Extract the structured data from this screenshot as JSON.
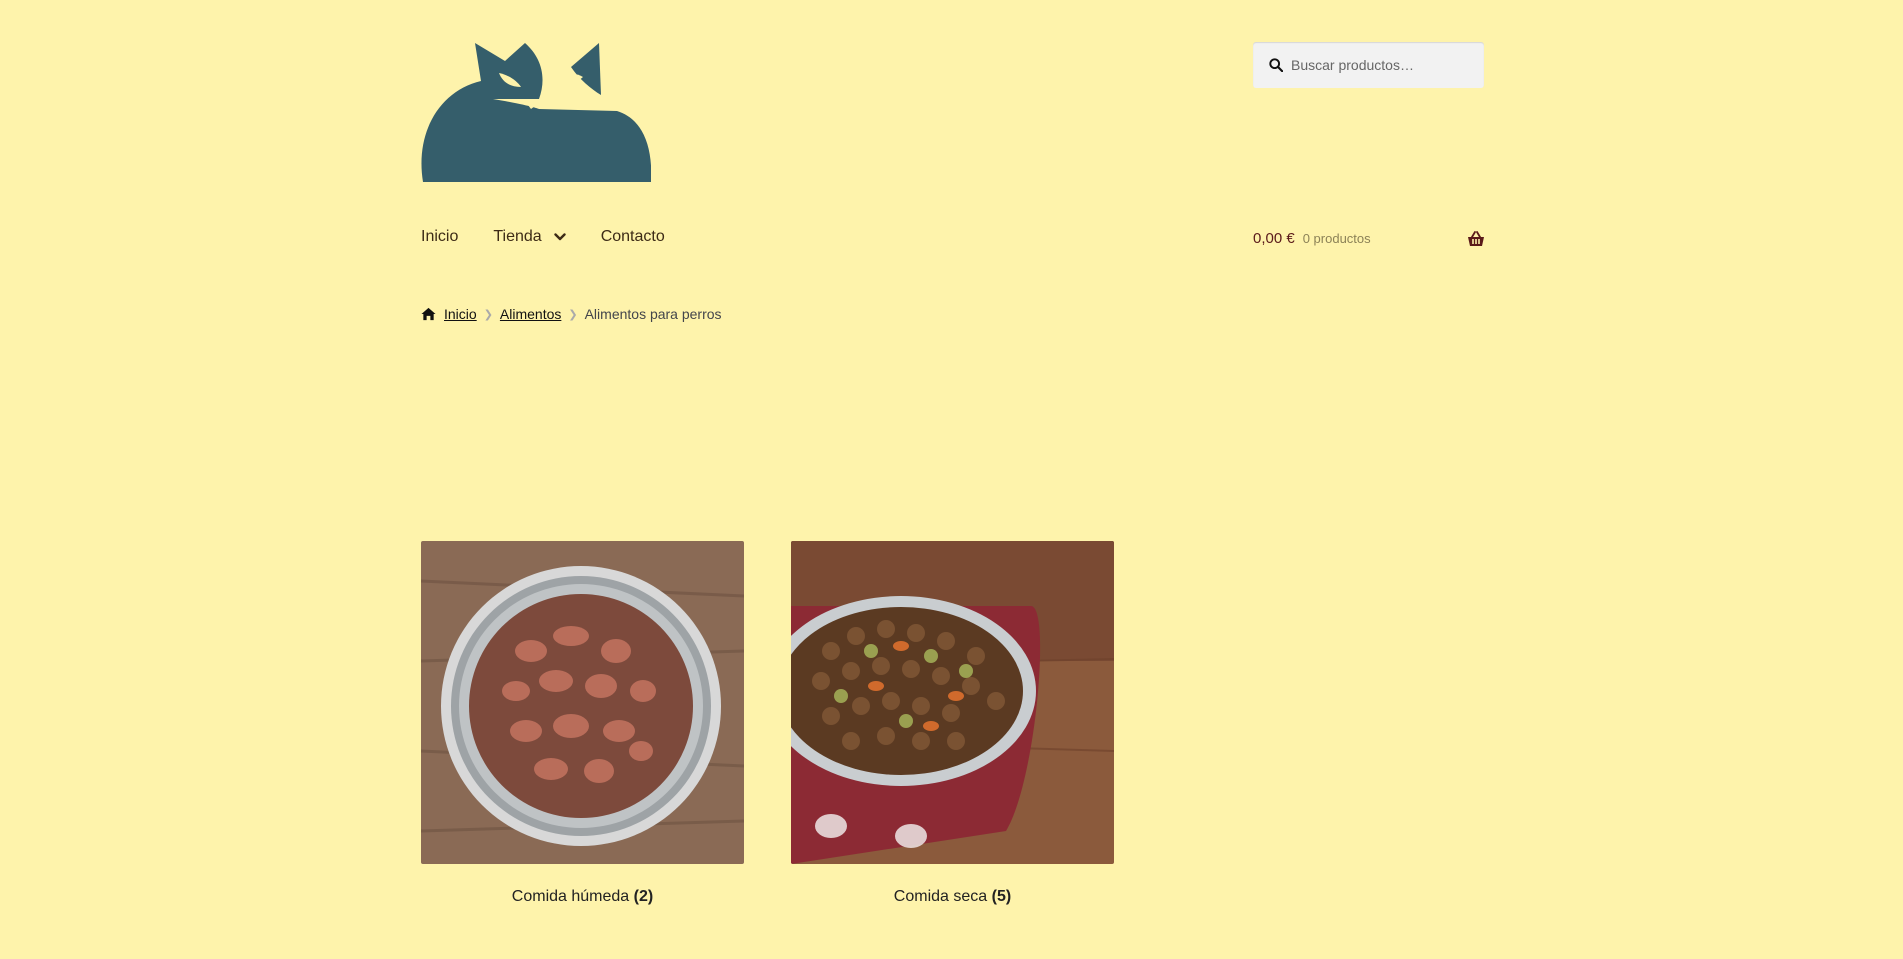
{
  "header": {
    "logo_icon": "cat-logo-icon",
    "search": {
      "placeholder": "Buscar productos…",
      "icon": "search-icon"
    }
  },
  "nav": {
    "items": [
      {
        "label": "Inicio"
      },
      {
        "label": "Tienda",
        "icon": "chevron-down-icon"
      },
      {
        "label": "Contacto"
      }
    ]
  },
  "cart": {
    "amount": "0,00 €",
    "count": "0 productos",
    "icon": "basket-icon"
  },
  "breadcrumb": {
    "home": "Inicio",
    "level1": "Alimentos",
    "current": "Alimentos para perros"
  },
  "categories": [
    {
      "name": "Comida húmeda",
      "count": "(2)",
      "image": "wet-food-bowl"
    },
    {
      "name": "Comida seca",
      "count": "(5)",
      "image": "dry-food-bowl"
    }
  ],
  "colors": {
    "background": "#fef3ab",
    "logo": "#355e6b",
    "nav_text": "#3d2b16",
    "cart_amount": "#5a1a1a"
  }
}
